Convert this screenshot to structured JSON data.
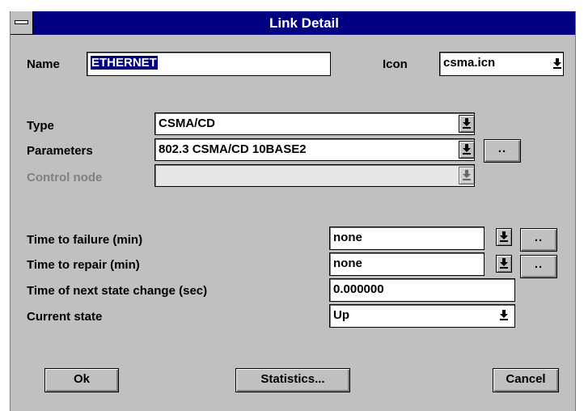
{
  "window": {
    "title": "Link Detail"
  },
  "name_row": {
    "label": "Name",
    "value": "ETHERNET",
    "icon_label": "Icon",
    "icon_value": "csma.icn"
  },
  "type": {
    "label": "Type",
    "value": "CSMA/CD"
  },
  "parameters": {
    "label": "Parameters",
    "value": "802.3 CSMA/CD 10BASE2",
    "button": ".."
  },
  "control_node": {
    "label": "Control node",
    "value": "",
    "enabled": false
  },
  "time_to_failure": {
    "label": "Time to failure (min)",
    "value": "none",
    "button": ".."
  },
  "time_to_repair": {
    "label": "Time to repair (min)",
    "value": "none",
    "button": ".."
  },
  "next_state_change": {
    "label": "Time of next state change (sec)",
    "value": "0.000000"
  },
  "current_state": {
    "label": "Current state",
    "value": "Up"
  },
  "buttons": {
    "ok": "Ok",
    "statistics": "Statistics...",
    "cancel": "Cancel"
  },
  "icons": {
    "system_menu": "minus-bar-icon",
    "dropdown": "down-arrow-underline-icon"
  },
  "colors": {
    "titlebar": "#000080",
    "face": "#c0c0c0",
    "selection": "#000080"
  }
}
